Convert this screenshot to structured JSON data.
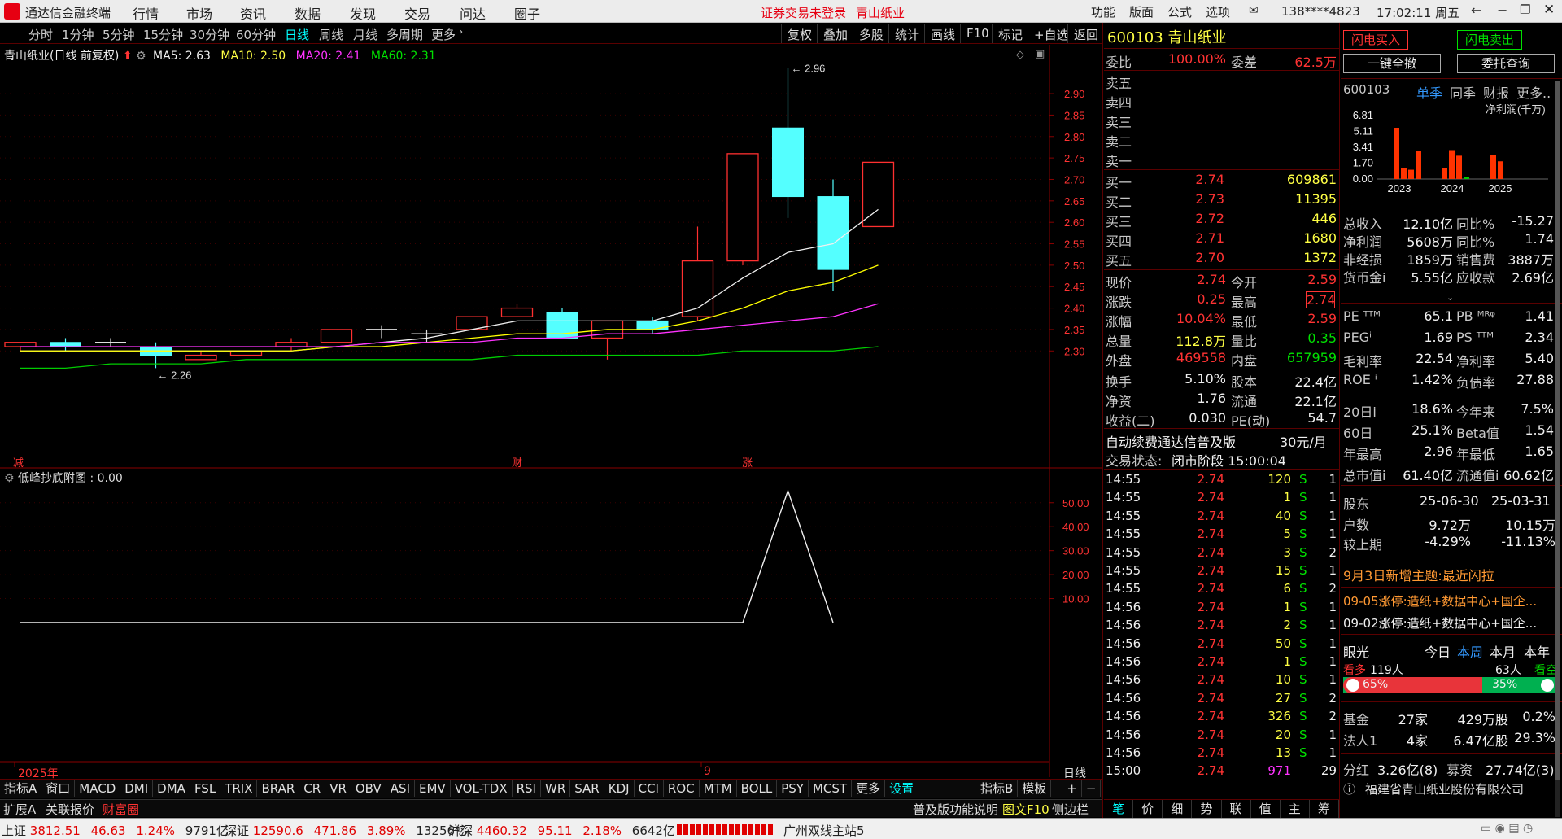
{
  "titlebar": {
    "app_name": "通达信金融终端",
    "menus": [
      "行情",
      "市场",
      "资讯",
      "数据",
      "发现",
      "交易",
      "问达",
      "圈子"
    ],
    "notice": "证券交易未登录",
    "stock": "青山纸业",
    "right_menus": [
      "功能",
      "版面",
      "公式",
      "选项"
    ],
    "account": "138****4823",
    "clock": "17:02:11 周五"
  },
  "toolbar": {
    "periods": [
      "分时",
      "1分钟",
      "5分钟",
      "15分钟",
      "30分钟",
      "60分钟",
      "日线",
      "周线",
      "月线",
      "多周期",
      "更多"
    ],
    "actions": [
      "复权",
      "叠加",
      "多股",
      "统计",
      "画线",
      "F10",
      "标记",
      "+自选",
      "返回"
    ]
  },
  "chart_header": {
    "name": "青山纸业(日线 前复权)",
    "ma5": "MA5: 2.63",
    "ma10": "MA10: 2.50",
    "ma20": "MA20: 2.41",
    "ma60": "MA60: 2.31",
    "colors": {
      "ma5": "#f0f0f0",
      "ma10": "#ffff00",
      "ma20": "#ff33ff",
      "ma60": "#00cc00"
    }
  },
  "markers": {
    "high": "2.96",
    "low": "2.26",
    "events": [
      "减",
      "财",
      "涨"
    ]
  },
  "chart_data": [
    {
      "type": "candlestick",
      "title": "青山纸业(日线 前复权)",
      "y_ticks": [
        "2.90",
        "2.85",
        "2.80",
        "2.75",
        "2.70",
        "2.65",
        "2.60",
        "2.55",
        "2.50",
        "2.45",
        "2.40",
        "2.35",
        "2.30"
      ],
      "ylim": [
        2.255,
        2.995
      ],
      "candles": [
        {
          "o": 2.31,
          "c": 2.32,
          "h": 2.32,
          "l": 2.3,
          "dir": "up"
        },
        {
          "o": 2.32,
          "c": 2.31,
          "h": 2.33,
          "l": 2.3,
          "dir": "down"
        },
        {
          "o": 2.32,
          "c": 2.32,
          "h": 2.33,
          "l": 2.31,
          "dir": "flat"
        },
        {
          "o": 2.31,
          "c": 2.29,
          "h": 2.32,
          "l": 2.26,
          "dir": "down"
        },
        {
          "o": 2.28,
          "c": 2.29,
          "h": 2.3,
          "l": 2.28,
          "dir": "up"
        },
        {
          "o": 2.29,
          "c": 2.3,
          "h": 2.3,
          "l": 2.29,
          "dir": "up"
        },
        {
          "o": 2.31,
          "c": 2.32,
          "h": 2.33,
          "l": 2.3,
          "dir": "up"
        },
        {
          "o": 2.32,
          "c": 2.35,
          "h": 2.35,
          "l": 2.32,
          "dir": "up"
        },
        {
          "o": 2.35,
          "c": 2.35,
          "h": 2.36,
          "l": 2.33,
          "dir": "flat"
        },
        {
          "o": 2.34,
          "c": 2.34,
          "h": 2.35,
          "l": 2.32,
          "dir": "flat"
        },
        {
          "o": 2.35,
          "c": 2.38,
          "h": 2.38,
          "l": 2.35,
          "dir": "up"
        },
        {
          "o": 2.38,
          "c": 2.4,
          "h": 2.41,
          "l": 2.38,
          "dir": "up"
        },
        {
          "o": 2.39,
          "c": 2.33,
          "h": 2.4,
          "l": 2.33,
          "dir": "down"
        },
        {
          "o": 2.33,
          "c": 2.37,
          "h": 2.37,
          "l": 2.28,
          "dir": "up"
        },
        {
          "o": 2.37,
          "c": 2.35,
          "h": 2.38,
          "l": 2.34,
          "dir": "down"
        },
        {
          "o": 2.38,
          "c": 2.51,
          "h": 2.59,
          "l": 2.37,
          "dir": "up"
        },
        {
          "o": 2.51,
          "c": 2.76,
          "h": 2.76,
          "l": 2.5,
          "dir": "up"
        },
        {
          "o": 2.82,
          "c": 2.66,
          "h": 2.96,
          "l": 2.61,
          "dir": "down"
        },
        {
          "o": 2.66,
          "c": 2.49,
          "h": 2.7,
          "l": 2.44,
          "dir": "down"
        },
        {
          "o": 2.59,
          "c": 2.74,
          "h": 2.74,
          "l": 2.59,
          "dir": "up"
        }
      ],
      "series": [
        {
          "name": "MA5",
          "values": [
            2.3,
            2.3,
            2.3,
            2.3,
            2.3,
            2.3,
            2.3,
            2.31,
            2.32,
            2.33,
            2.35,
            2.37,
            2.37,
            2.37,
            2.37,
            2.4,
            2.47,
            2.53,
            2.55,
            2.63
          ]
        },
        {
          "name": "MA10",
          "values": [
            2.3,
            2.3,
            2.3,
            2.3,
            2.3,
            2.3,
            2.3,
            2.31,
            2.31,
            2.32,
            2.33,
            2.34,
            2.34,
            2.35,
            2.35,
            2.37,
            2.4,
            2.44,
            2.46,
            2.5
          ]
        },
        {
          "name": "MA20",
          "values": [
            2.31,
            2.31,
            2.31,
            2.31,
            2.31,
            2.31,
            2.31,
            2.31,
            2.32,
            2.32,
            2.32,
            2.33,
            2.33,
            2.34,
            2.34,
            2.35,
            2.36,
            2.37,
            2.38,
            2.41
          ]
        },
        {
          "name": "MA60",
          "values": [
            2.26,
            2.26,
            2.27,
            2.27,
            2.27,
            2.28,
            2.28,
            2.28,
            2.28,
            2.28,
            2.28,
            2.29,
            2.29,
            2.29,
            2.29,
            2.29,
            2.3,
            2.3,
            2.3,
            2.31
          ]
        }
      ]
    },
    {
      "type": "line",
      "title": "低峰抄底附图 : 0.00",
      "y_ticks": [
        "50.00",
        "40.00",
        "30.00",
        "20.00",
        "10.00"
      ],
      "ylim": [
        0,
        56
      ],
      "series": [
        {
          "name": "低峰抄底附图",
          "values": [
            0,
            0,
            0,
            0,
            0,
            0,
            0,
            0,
            0,
            0,
            0,
            0,
            0,
            0,
            0,
            0,
            0,
            55,
            0
          ]
        }
      ]
    }
  ],
  "x_axis": {
    "year": "2025年",
    "month": "9",
    "mode": "日线"
  },
  "indicators": [
    "指标A",
    "窗口",
    "MACD",
    "DMI",
    "DMA",
    "FSL",
    "TRIX",
    "BRAR",
    "CR",
    "VR",
    "OBV",
    "ASI",
    "EMV",
    "VOL-TDX",
    "RSI",
    "WR",
    "SAR",
    "KDJ",
    "CCI",
    "ROC",
    "MTM",
    "BOLL",
    "PSY",
    "MCST",
    "更多",
    "设置"
  ],
  "indicator_right": [
    "指标B",
    "模板",
    "+",
    "−"
  ],
  "tabs_bottom": [
    "扩展A",
    "关联报价",
    "财富圈"
  ],
  "bottom_links": [
    "普及版功能说明",
    "图文F10",
    "侧边栏"
  ],
  "quote": {
    "code": "600103",
    "name": "青山纸业",
    "webi_label": "委比",
    "webi": "100.00%",
    "weicha_label": "委差",
    "weicha": "62.5万",
    "sells": [
      "卖五",
      "卖四",
      "卖三",
      "卖二",
      "卖一"
    ],
    "buys": [
      {
        "label": "买一",
        "price": "2.74",
        "vol": "609861"
      },
      {
        "label": "买二",
        "price": "2.73",
        "vol": "11395"
      },
      {
        "label": "买三",
        "price": "2.72",
        "vol": "446"
      },
      {
        "label": "买四",
        "price": "2.71",
        "vol": "1680"
      },
      {
        "label": "买五",
        "price": "2.70",
        "vol": "1372"
      }
    ],
    "stats": [
      {
        "l1": "现价",
        "v1": "2.74",
        "l2": "今开",
        "v2": "2.59"
      },
      {
        "l1": "涨跌",
        "v1": "0.25",
        "l2": "最高",
        "v2": "2.74"
      },
      {
        "l1": "涨幅",
        "v1": "10.04%",
        "l2": "最低",
        "v2": "2.59"
      },
      {
        "l1": "总量",
        "v1": "112.8万",
        "l2": "量比",
        "v2": "0.35"
      },
      {
        "l1": "外盘",
        "v1": "469558",
        "l2": "内盘",
        "v2": "657959"
      }
    ],
    "stats2": [
      {
        "l1": "换手",
        "v1": "5.10%",
        "l2": "股本",
        "v2": "22.4亿"
      },
      {
        "l1": "净资",
        "v1": "1.76",
        "l2": "流通",
        "v2": "22.1亿"
      },
      {
        "l1": "收益(二)",
        "v1": "0.030",
        "l2": "PE(动)",
        "v2": "54.7"
      }
    ],
    "promo": "自动续费通达信普及版",
    "promo_price": "30元/月",
    "state_label": "交易状态:",
    "state": "闭市阶段 15:00:04"
  },
  "ticks": [
    {
      "t": "14:55",
      "p": "2.74",
      "v": "120",
      "s": "S",
      "n": "1"
    },
    {
      "t": "14:55",
      "p": "2.74",
      "v": "1",
      "s": "S",
      "n": "1"
    },
    {
      "t": "14:55",
      "p": "2.74",
      "v": "40",
      "s": "S",
      "n": "1"
    },
    {
      "t": "14:55",
      "p": "2.74",
      "v": "5",
      "s": "S",
      "n": "1"
    },
    {
      "t": "14:55",
      "p": "2.74",
      "v": "3",
      "s": "S",
      "n": "2"
    },
    {
      "t": "14:55",
      "p": "2.74",
      "v": "15",
      "s": "S",
      "n": "1"
    },
    {
      "t": "14:55",
      "p": "2.74",
      "v": "6",
      "s": "S",
      "n": "2"
    },
    {
      "t": "14:56",
      "p": "2.74",
      "v": "1",
      "s": "S",
      "n": "1"
    },
    {
      "t": "14:56",
      "p": "2.74",
      "v": "2",
      "s": "S",
      "n": "1"
    },
    {
      "t": "14:56",
      "p": "2.74",
      "v": "50",
      "s": "S",
      "n": "1"
    },
    {
      "t": "14:56",
      "p": "2.74",
      "v": "1",
      "s": "S",
      "n": "1"
    },
    {
      "t": "14:56",
      "p": "2.74",
      "v": "10",
      "s": "S",
      "n": "1"
    },
    {
      "t": "14:56",
      "p": "2.74",
      "v": "27",
      "s": "S",
      "n": "2"
    },
    {
      "t": "14:56",
      "p": "2.74",
      "v": "326",
      "s": "S",
      "n": "2"
    },
    {
      "t": "14:56",
      "p": "2.74",
      "v": "20",
      "s": "S",
      "n": "1"
    },
    {
      "t": "14:56",
      "p": "2.74",
      "v": "13",
      "s": "S",
      "n": "1"
    },
    {
      "t": "15:00",
      "p": "2.74",
      "v": "971",
      "s": "",
      "n": "29"
    }
  ],
  "tick_tabs": [
    "笔",
    "价",
    "细",
    "势",
    "联",
    "值",
    "主",
    "筹"
  ],
  "right": {
    "buy_btn": "闪电买入",
    "sell_btn": "闪电卖出",
    "cancel_all": "一键全撤",
    "query": "委托查询",
    "code": "600103",
    "tabs": [
      "单季",
      "同季",
      "财报",
      "更多.."
    ],
    "fin_unit": "净利润(千万)",
    "fin_y": [
      "6.81",
      "5.11",
      "3.41",
      "1.70",
      "0.00"
    ],
    "fin_x": [
      "2023",
      "2024",
      "2025"
    ],
    "fin_bars": [
      5.5,
      1.2,
      1.0,
      3.0,
      1.2,
      3.1,
      2.5,
      0.2,
      2.6,
      1.9
    ],
    "fin_bar_colors": [
      "#ff3300",
      "#ff3300",
      "#ff3300",
      "#ff3300",
      "#ff3300",
      "#ff3300",
      "#ff3300",
      "#00cc00",
      "#ff3300",
      "#ff3300"
    ],
    "fin": [
      {
        "l1": "总收入",
        "v1": "12.10亿",
        "l2": "同比%",
        "v2": "-15.27"
      },
      {
        "l1": "净利润",
        "v1": "5608万",
        "l2": "同比%",
        "v2": "1.74"
      },
      {
        "l1": "非经损",
        "v1": "1859万",
        "l2": "销售费",
        "v2": "3887万"
      },
      {
        "l1": "货币金i",
        "v1": "5.55亿",
        "l2": "应收款",
        "v2": "2.69亿"
      }
    ],
    "val": [
      {
        "l1": "PE ᵀᵀᴹ",
        "v1": "65.1",
        "l2": "PB ᴹᴿᵠ",
        "v2": "1.41"
      },
      {
        "l1": "PEGⁱ",
        "v1": "1.69",
        "l2": "PS ᵀᵀᴹ",
        "v2": "2.34"
      },
      {
        "l1": "毛利率",
        "v1": "22.54",
        "l2": "净利率",
        "v2": "5.40"
      },
      {
        "l1": "ROE ⁱ",
        "v1": "1.42%",
        "l2": "负债率",
        "v2": "27.88"
      }
    ],
    "perf": [
      {
        "l1": "20日i",
        "v1": "18.6%",
        "l2": "今年来",
        "v2": "7.5%"
      },
      {
        "l1": "60日",
        "v1": "25.1%",
        "l2": "Beta值",
        "v2": "1.54"
      },
      {
        "l1": "年最高",
        "v1": "2.96",
        "l2": "年最低",
        "v2": "1.65"
      },
      {
        "l1": "总市值i",
        "v1": "61.40亿",
        "l2": "流通值i",
        "v2": "60.62亿"
      }
    ],
    "holders": {
      "label": "股东",
      "d1": "25-06-30",
      "d2": "25-03-31",
      "rows": [
        {
          "l": "户数",
          "a": "9.72万",
          "b": "10.15万"
        },
        {
          "l": "较上期",
          "a": "-4.29%",
          "b": "-11.13%"
        }
      ]
    },
    "theme": "9月3日新增主题:最近闪拉",
    "news": [
      "09-05涨停:造纸+数据中心+国企...",
      "09-02涨停:造纸+数据中心+国企..."
    ],
    "eye": "眼光",
    "eye_tabs": [
      "今日",
      "本周",
      "本月",
      "本年"
    ],
    "bull": "看多",
    "bull_n": "119人",
    "bear_n": "63人",
    "bear": "看空",
    "bull_pct": "65%",
    "bear_pct": "35%",
    "bull_ratio": 0.65,
    "funds": [
      {
        "l": "基金",
        "a": "27家",
        "b": "429万股",
        "c": "0.2%"
      },
      {
        "l": "法人1",
        "a": "4家",
        "b": "6.47亿股",
        "c": "29.3%"
      }
    ],
    "dividend": {
      "l1": "分红",
      "v1": "3.26亿(8)",
      "l2": "募资",
      "v2": "27.74亿(3)"
    },
    "company": "福建省青山纸业股份有限公司"
  },
  "statusbar": {
    "sh_label": "上证",
    "sh": "3812.51",
    "sh_chg": "46.63",
    "sh_pct": "1.24%",
    "sh_amt": "9791亿",
    "sz_label": "深证",
    "sz": "12590.6",
    "sz_chg": "471.86",
    "sz_pct": "3.89%",
    "sz_amt": "13256亿",
    "hs_label": "沪深",
    "hs": "4460.32",
    "hs_chg": "95.11",
    "hs_pct": "2.18%",
    "hs_amt": "6642亿",
    "server": "广州双线主站5"
  }
}
